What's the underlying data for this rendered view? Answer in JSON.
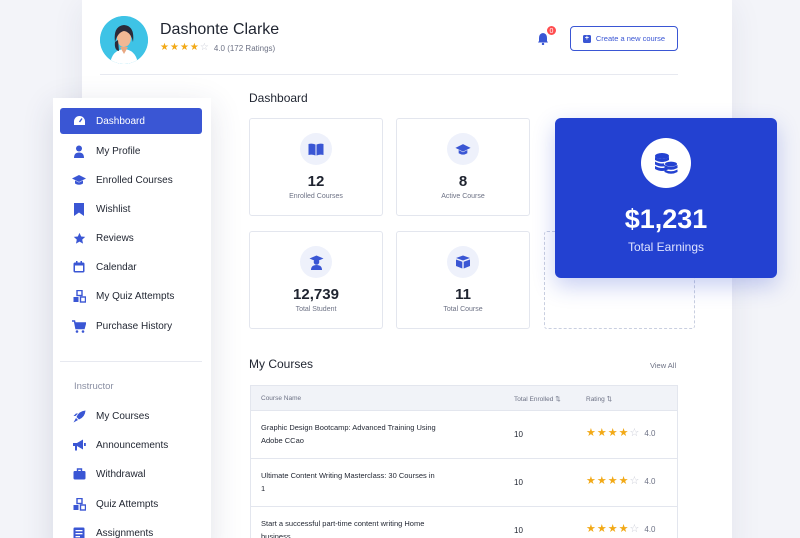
{
  "profile": {
    "name": "Dashonte Clarke",
    "rating_text": "4.0 (172 Ratings)",
    "stars": 4,
    "notification_count": "0",
    "create_button_label": "Create a new course"
  },
  "sidebar": {
    "items": [
      {
        "label": "Dashboard",
        "icon": "dashboard-icon"
      },
      {
        "label": "My Profile",
        "icon": "user-icon"
      },
      {
        "label": "Enrolled Courses",
        "icon": "graduation-cap-icon"
      },
      {
        "label": "Wishlist",
        "icon": "bookmark-icon"
      },
      {
        "label": "Reviews",
        "icon": "star-icon"
      },
      {
        "label": "Calendar",
        "icon": "calendar-icon"
      },
      {
        "label": "My Quiz Attempts",
        "icon": "puzzle-icon"
      },
      {
        "label": "Purchase History",
        "icon": "cart-icon"
      }
    ],
    "instructor_label": "Instructor",
    "instructor_items": [
      {
        "label": "My Courses",
        "icon": "rocket-icon"
      },
      {
        "label": "Announcements",
        "icon": "megaphone-icon"
      },
      {
        "label": "Withdrawal",
        "icon": "briefcase-icon"
      },
      {
        "label": "Quiz Attempts",
        "icon": "puzzle-icon"
      },
      {
        "label": "Assignments",
        "icon": "assignment-icon"
      }
    ]
  },
  "dashboard": {
    "title": "Dashboard",
    "stats": [
      {
        "value": "12",
        "label": "Enrolled Courses",
        "icon": "book-icon"
      },
      {
        "value": "8",
        "label": "Active Course",
        "icon": "graduation-cap-icon"
      },
      {
        "value": "12,739",
        "label": "Total Student",
        "icon": "student-icon"
      },
      {
        "value": "11",
        "label": "Total Course",
        "icon": "boxes-icon"
      }
    ],
    "earnings": {
      "value": "$1,231",
      "label": "Total Earnings",
      "icon": "coins-icon"
    }
  },
  "courses": {
    "title": "My Courses",
    "view_all": "View All",
    "columns": [
      "Course Name",
      "Total Enrolled",
      "Rating"
    ],
    "rows": [
      {
        "name": "Graphic Design Bootcamp: Advanced Training Using Adobe CCao",
        "enrolled": "10",
        "stars": 4,
        "rating": "4.0"
      },
      {
        "name": "Ultimate Content Writing Masterclass: 30 Courses in 1",
        "enrolled": "10",
        "stars": 4,
        "rating": "4.0"
      },
      {
        "name": "Start a successful part-time content writing Home business",
        "enrolled": "10",
        "stars": 4,
        "rating": "4.0"
      }
    ]
  },
  "colors": {
    "primary": "#2341d1",
    "accent": "#3a56d4",
    "star": "#f2a916"
  }
}
